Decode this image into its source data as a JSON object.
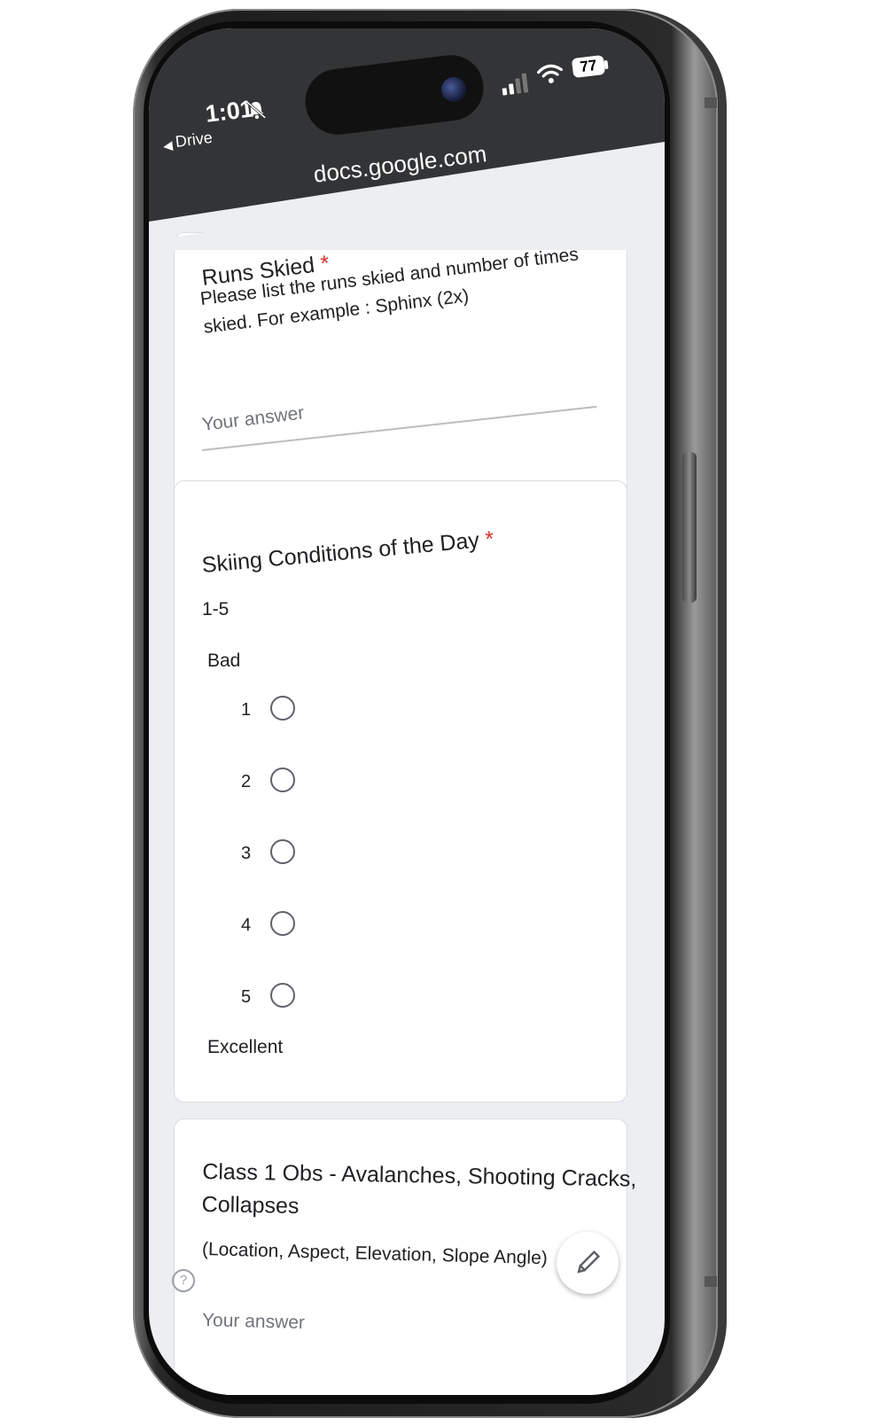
{
  "status_bar": {
    "time": "1:01",
    "battery": "77"
  },
  "browser": {
    "back_label": "Drive",
    "url": "docs.google.com"
  },
  "questions": [
    {
      "title": "Runs Skied",
      "required_mark": "*",
      "description_line1": "Please list the runs skied and number of times",
      "description_line2": "skied. For example : Sphinx (2x)",
      "answer_placeholder": "Your answer"
    },
    {
      "title": "Skiing Conditions of the Day",
      "required_mark": "*",
      "description": "1-5",
      "low_label": "Bad",
      "high_label": "Excellent",
      "options": [
        "1",
        "2",
        "3",
        "4",
        "5"
      ]
    },
    {
      "title_line1": "Class 1 Obs - Avalanches, Shooting Cracks,",
      "title_line2": "Collapses",
      "description": "(Location, Aspect, Elevation, Slope Angle)",
      "answer_placeholder": "Your answer"
    }
  ],
  "help_icon": "?",
  "icons": [
    "bell-off-icon",
    "signal-icon",
    "wifi-icon",
    "battery-icon",
    "help-icon",
    "pencil-icon"
  ]
}
